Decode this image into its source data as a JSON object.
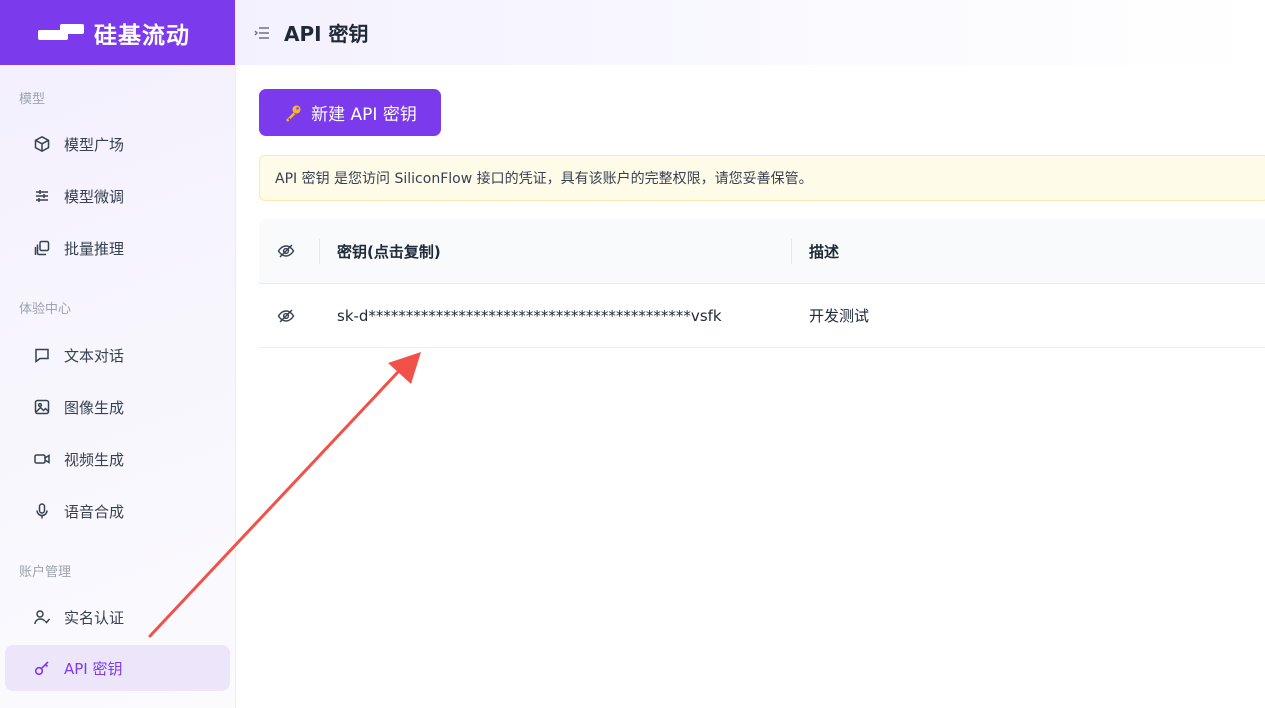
{
  "brand": {
    "name": "硅基流动"
  },
  "header": {
    "title": "API 密钥"
  },
  "sidebar": {
    "sections": [
      {
        "label": "模型"
      },
      {
        "label": "体验中心"
      },
      {
        "label": "账户管理"
      }
    ],
    "items": [
      {
        "label": "模型广场",
        "icon": "cube-icon"
      },
      {
        "label": "模型微调",
        "icon": "sliders-icon"
      },
      {
        "label": "批量推理",
        "icon": "batch-icon"
      },
      {
        "label": "文本对话",
        "icon": "chat-icon"
      },
      {
        "label": "图像生成",
        "icon": "image-icon"
      },
      {
        "label": "视频生成",
        "icon": "video-icon"
      },
      {
        "label": "语音合成",
        "icon": "mic-icon"
      },
      {
        "label": "实名认证",
        "icon": "user-check-icon"
      },
      {
        "label": "API 密钥",
        "icon": "key-icon",
        "active": true
      }
    ]
  },
  "main": {
    "new_button_label": "新建 API 密钥",
    "notice": "API 密钥 是您访问 SiliconFlow 接口的凭证，具有该账户的完整权限，请您妥善保管。",
    "table": {
      "columns": [
        "密钥(点击复制)",
        "描述"
      ],
      "rows": [
        {
          "key": "sk-d*******************************************vsfk",
          "description": "开发测试"
        }
      ]
    }
  },
  "colors": {
    "accent": "#7c3aed",
    "notice_bg": "#fefbe8",
    "annotation_arrow": "#f2514a"
  }
}
